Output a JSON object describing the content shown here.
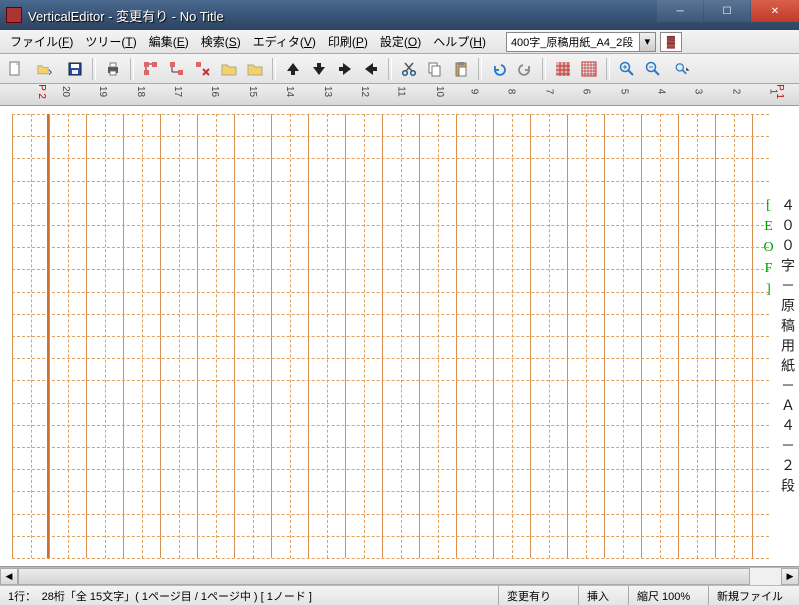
{
  "window": {
    "title": "VerticalEditor - 変更有り - No Title"
  },
  "menu": {
    "file": "ファイル(",
    "file_key": "F",
    "file_end": ")",
    "tree": "ツリー(",
    "tree_key": "T",
    "tree_end": ")",
    "edit": "編集(",
    "edit_key": "E",
    "edit_end": ")",
    "search": "検索(",
    "search_key": "S",
    "search_end": ")",
    "editor": "エディタ(",
    "editor_key": "V",
    "editor_end": ")",
    "print": "印刷(",
    "print_key": "P",
    "print_end": ")",
    "settings": "設定(",
    "settings_key": "O",
    "settings_end": ")",
    "help": "ヘルプ(",
    "help_key": "H",
    "help_end": ")",
    "doc_selected": "400字_原稿用紙_A4_2段"
  },
  "ruler": {
    "page_left": "P 2",
    "page_right": "P 1",
    "ticks": [
      "20",
      "19",
      "18",
      "17",
      "16",
      "15",
      "14",
      "13",
      "12",
      "11",
      "10",
      "9",
      "8",
      "7",
      "6",
      "5",
      "4",
      "3",
      "2",
      "1"
    ]
  },
  "content": {
    "line1": "４００字－原稿用紙－Ａ４－２段",
    "eof": "[EOF]"
  },
  "status": {
    "pos": "1行：　28桁「全 15文字」( 1ページ目 / 1ページ中 ) [ 1ノード ]",
    "changed": "変更有り",
    "insert": "挿入",
    "zoom": "縮尺 100%",
    "file": "新規ファイル"
  }
}
